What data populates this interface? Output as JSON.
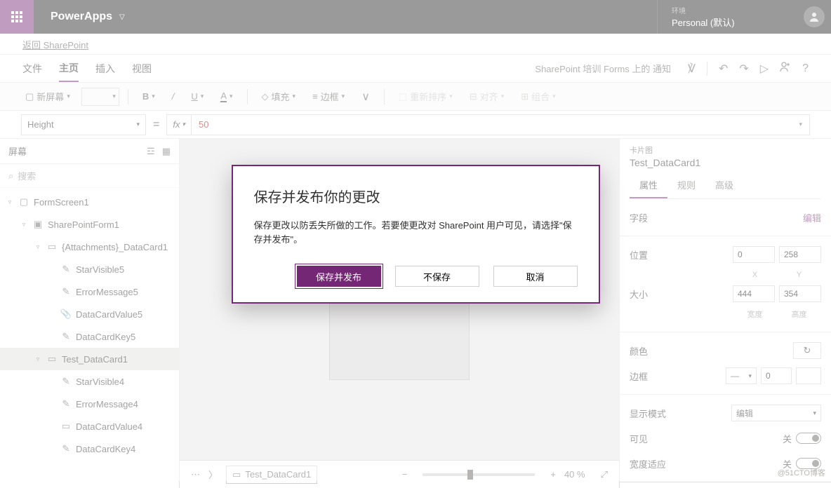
{
  "titlebar": {
    "app": "PowerApps",
    "env_label": "环境",
    "env_value": "Personal (默认)"
  },
  "backlink": {
    "label": "返回 SharePoint"
  },
  "menu": {
    "items": [
      "文件",
      "主页",
      "插入",
      "视图"
    ],
    "active": 1,
    "connector": "SharePoint 培训 Forms 上的 通知"
  },
  "toolbar": {
    "new_screen": "新屏幕",
    "fill": "填充",
    "border": "边框",
    "reorder": "重新排序",
    "align": "对齐",
    "group": "组合"
  },
  "formula": {
    "property": "Height",
    "value": "50"
  },
  "left": {
    "title": "屏幕",
    "search": "搜索",
    "items": [
      {
        "d": 0,
        "exp": true,
        "icon": "screen",
        "label": "FormScreen1"
      },
      {
        "d": 1,
        "exp": true,
        "icon": "form",
        "label": "SharePointForm1"
      },
      {
        "d": 2,
        "exp": true,
        "icon": "card",
        "label": "{Attachments}_DataCard1"
      },
      {
        "d": 3,
        "exp": false,
        "icon": "star",
        "label": "StarVisible5"
      },
      {
        "d": 3,
        "exp": false,
        "icon": "err",
        "label": "ErrorMessage5"
      },
      {
        "d": 3,
        "exp": false,
        "icon": "attach",
        "label": "DataCardValue5"
      },
      {
        "d": 3,
        "exp": false,
        "icon": "key",
        "label": "DataCardKey5"
      },
      {
        "d": 2,
        "exp": true,
        "icon": "card",
        "label": "Test_DataCard1",
        "sel": true
      },
      {
        "d": 3,
        "exp": false,
        "icon": "star",
        "label": "StarVisible4"
      },
      {
        "d": 3,
        "exp": false,
        "icon": "err",
        "label": "ErrorMessage4"
      },
      {
        "d": 3,
        "exp": false,
        "icon": "val",
        "label": "DataCardValue4"
      },
      {
        "d": 3,
        "exp": false,
        "icon": "key",
        "label": "DataCardKey4"
      }
    ]
  },
  "canvas": {
    "breadcrumb": "Test_DataCard1",
    "zoom": "40",
    "zoom_unit": "%"
  },
  "right": {
    "sub": "卡片图",
    "title": "Test_DataCard1",
    "tabs": [
      "属性",
      "规则",
      "高级"
    ],
    "active": 0,
    "field_label": "字段",
    "field_action": "编辑",
    "pos_label": "位置",
    "pos_x": "0",
    "pos_y": "258",
    "xl": "X",
    "yl": "Y",
    "size_label": "大小",
    "w": "444",
    "h": "354",
    "wl": "宽度",
    "hl": "高度",
    "color_label": "颜色",
    "border_label": "边框",
    "border_w": "0",
    "mode_label": "显示模式",
    "mode_val": "编辑",
    "visible_label": "可见",
    "visible_val": "关",
    "widthfit_label": "宽度适应",
    "widthfit_val": "关"
  },
  "dialog": {
    "title": "保存并发布你的更改",
    "body": "保存更改以防丢失所做的工作。若要使更改对 SharePoint 用户可见，请选择\"保存并发布\"。",
    "primary": "保存并发布",
    "secondary": "不保存",
    "cancel": "取消"
  },
  "watermark": "@51CTO博客"
}
